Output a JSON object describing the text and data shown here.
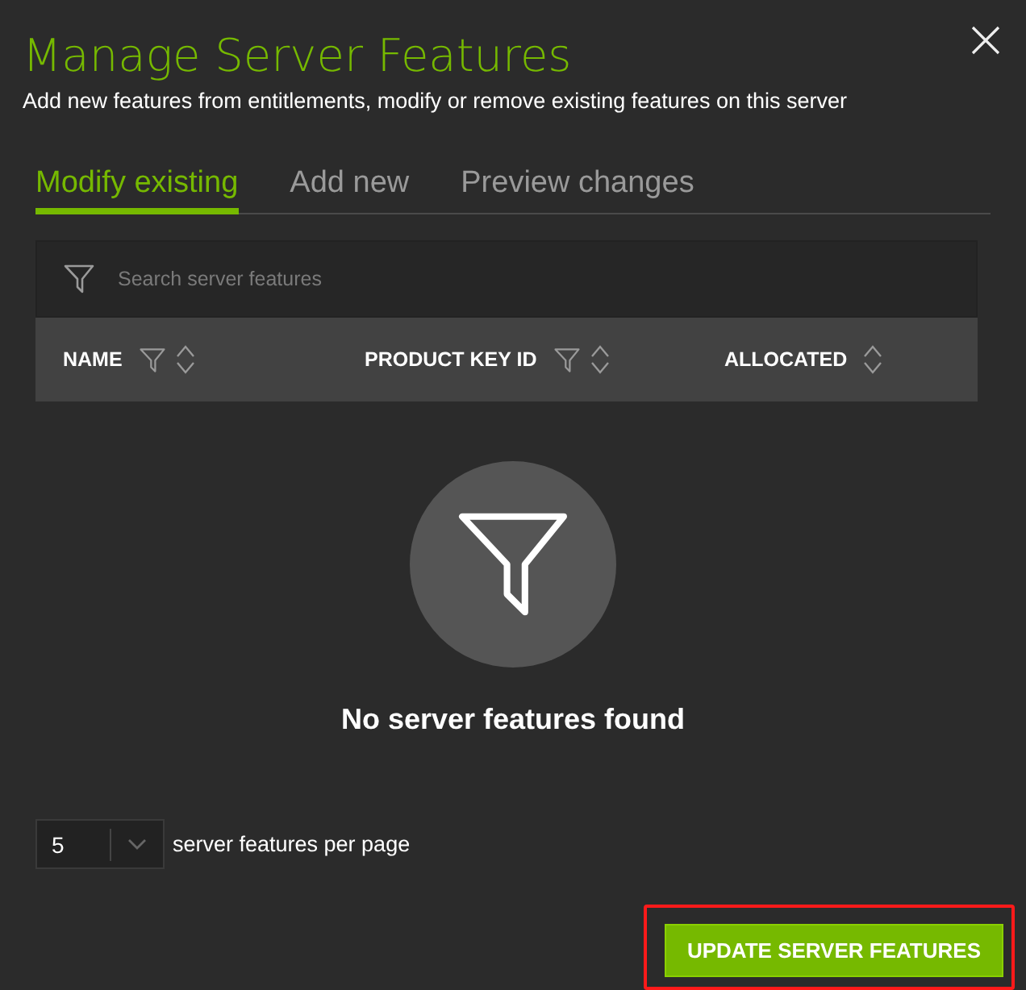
{
  "dialog": {
    "title": "Manage Server Features",
    "subtitle": "Add new features from entitlements, modify or remove existing features on this server"
  },
  "tabs": [
    {
      "label": "Modify existing",
      "selected": true
    },
    {
      "label": "Add new",
      "selected": false
    },
    {
      "label": "Preview changes",
      "selected": false
    }
  ],
  "search": {
    "placeholder": "Search server features"
  },
  "table": {
    "columns": [
      {
        "label": "NAME",
        "filter": true
      },
      {
        "label": "PRODUCT KEY ID",
        "filter": true
      },
      {
        "label": "ALLOCATED",
        "filter": false
      }
    ]
  },
  "empty_state": {
    "message": "No server features found"
  },
  "pagination": {
    "page_size": "5",
    "label": "server features per page"
  },
  "buttons": [
    {
      "label": "UPDATE SERVER FEATURES",
      "highlighted": true
    }
  ]
}
